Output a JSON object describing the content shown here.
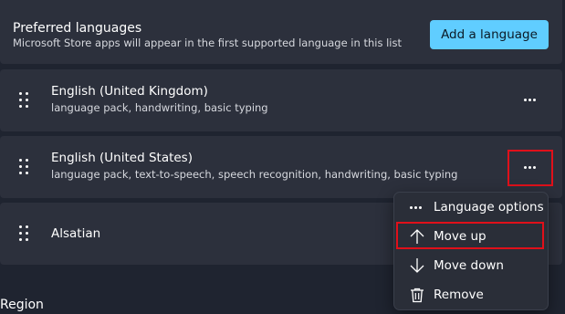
{
  "header": {
    "title": "Preferred languages",
    "subtitle": "Microsoft Store apps will appear in the first supported language in this list",
    "add_button_label": "Add a language"
  },
  "languages": [
    {
      "name": "English (United Kingdom)",
      "features": "language pack, handwriting, basic typing"
    },
    {
      "name": "English (United States)",
      "features": "language pack, text-to-speech, speech recognition, handwriting, basic typing"
    },
    {
      "name": "Alsatian",
      "features": ""
    }
  ],
  "context_menu": {
    "items": [
      {
        "label": "Language options",
        "icon": "more-horizontal-icon"
      },
      {
        "label": "Move up",
        "icon": "arrow-up-icon"
      },
      {
        "label": "Move down",
        "icon": "arrow-down-icon"
      },
      {
        "label": "Remove",
        "icon": "trash-icon"
      }
    ]
  },
  "section_heading": "Region",
  "colors": {
    "accent": "#60cdff",
    "card_background": "#2c303c",
    "page_background": "#1f2430",
    "highlight_box": "#e0101a"
  }
}
